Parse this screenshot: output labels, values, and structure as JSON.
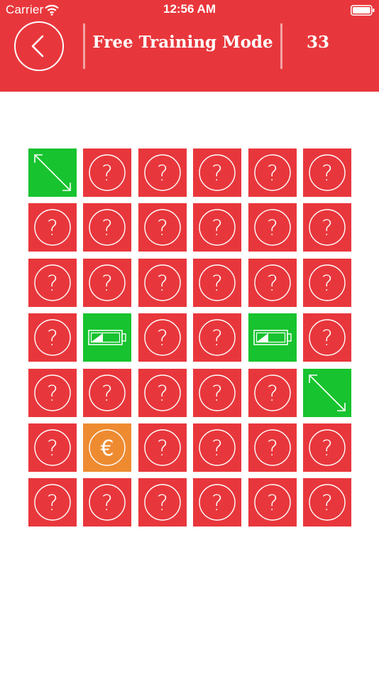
{
  "status_bar": {
    "carrier": "Carrier",
    "time": "12:56 AM",
    "wifi_icon": "wifi-icon",
    "battery_icon": "battery-full-icon"
  },
  "header": {
    "back_icon": "chevron-left-icon",
    "title": "Free Training Mode",
    "score": "33",
    "color": "#e8373c"
  },
  "board": {
    "rows": 7,
    "columns": 6,
    "tiles": [
      [
        "arrow-diagonal",
        "question",
        "question",
        "question",
        "question",
        "question"
      ],
      [
        "question",
        "question",
        "question",
        "question",
        "question",
        "question"
      ],
      [
        "question",
        "question",
        "question",
        "question",
        "question",
        "question"
      ],
      [
        "question",
        "battery",
        "question",
        "question",
        "battery",
        "question"
      ],
      [
        "question",
        "question",
        "question",
        "question",
        "question",
        "arrow-diagonal"
      ],
      [
        "question",
        "euro",
        "question",
        "question",
        "question",
        "question"
      ],
      [
        "question",
        "question",
        "question",
        "question",
        "question",
        "question"
      ]
    ],
    "colors": {
      "hidden": "#e8373c",
      "revealed_good": "#17c32e",
      "revealed_coin": "#ee8b31"
    },
    "icon_names": {
      "question": "question-icon",
      "arrow-diagonal": "diagonal-arrow-icon",
      "battery": "battery-icon",
      "euro": "euro-coin-icon"
    }
  }
}
